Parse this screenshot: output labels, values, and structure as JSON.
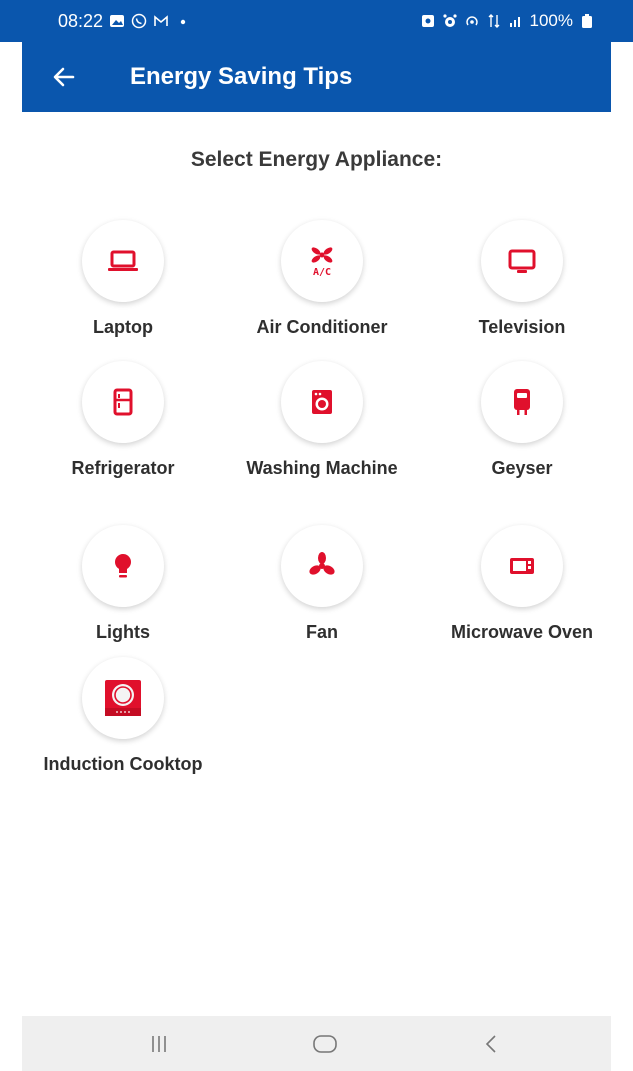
{
  "status_bar": {
    "time": "08:22",
    "battery_text": "100%",
    "icons_left": [
      "gallery-icon",
      "whatsapp-icon",
      "gmail-icon",
      "dot-icon"
    ],
    "icons_right": [
      "nfc-icon",
      "alarm-icon",
      "hotspot-icon",
      "data-icon",
      "signal-icon",
      "battery-icon"
    ]
  },
  "app_bar": {
    "title": "Energy Saving Tips",
    "back_icon": "arrow-left-icon"
  },
  "main": {
    "section_title": "Select Energy Appliance:",
    "appliances": [
      {
        "label": "Laptop",
        "icon": "laptop-icon"
      },
      {
        "label": "Air Conditioner",
        "icon": "ac-icon"
      },
      {
        "label": "Television",
        "icon": "tv-icon"
      },
      {
        "label": "Refrigerator",
        "icon": "fridge-icon"
      },
      {
        "label": "Washing Machine",
        "icon": "washing-machine-icon"
      },
      {
        "label": "Geyser",
        "icon": "geyser-icon"
      },
      {
        "label": "Lights",
        "icon": "bulb-icon"
      },
      {
        "label": "Fan",
        "icon": "fan-icon"
      },
      {
        "label": "Microwave Oven",
        "icon": "microwave-icon"
      },
      {
        "label": "Induction Cooktop",
        "icon": "cooktop-icon"
      }
    ]
  },
  "colors": {
    "primary": "#0a56ad",
    "accent": "#e0102c"
  },
  "nav_bar": {
    "buttons": [
      "recents-icon",
      "home-icon",
      "back-icon"
    ]
  }
}
